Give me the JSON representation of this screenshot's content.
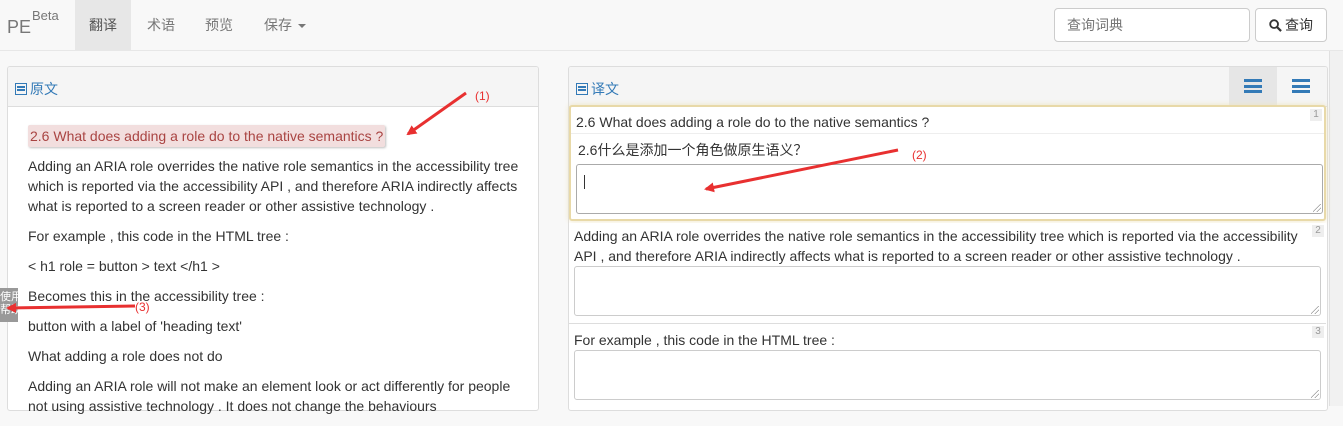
{
  "navbar": {
    "brand": "PE",
    "brand_sup": "Beta",
    "items": [
      {
        "label": "翻译"
      },
      {
        "label": "术语"
      },
      {
        "label": "预览"
      },
      {
        "label": "保存"
      }
    ],
    "search_placeholder": "查询词典",
    "search_button": "查询"
  },
  "source_panel": {
    "title": "原文",
    "highlighted": "2.6 What does adding a role do to the native semantics ?",
    "paragraphs": [
      "Adding an ARIA role overrides the native role semantics in the accessibility tree which is reported via the accessibility API , and therefore ARIA indirectly affects what is reported to a screen reader or other assistive technology .",
      "For example , this code in the HTML tree :",
      "< h1 role = button > text </h1 >",
      "Becomes this in the accessibility tree :",
      "button with a label of 'heading text'",
      "What adding a role does not do",
      "Adding an ARIA role will not make an element look or act differently for people not using assistive technology . It does not change the behaviours"
    ],
    "side_tab": "使用\n帮助"
  },
  "target_panel": {
    "title": "译文",
    "segments": [
      {
        "number": "1",
        "source": "2.6 What does adding a role do to the native semantics ?",
        "suggestion": "2.6什么是添加一个角色做原生语义？",
        "value": ""
      },
      {
        "number": "2",
        "source": "Adding an ARIA role overrides the native role semantics in the accessibility tree which is reported via the accessibility API , and therefore ARIA indirectly affects what is reported to a screen reader or other assistive technology .",
        "value": ""
      },
      {
        "number": "3",
        "source": "For example , this code in the HTML tree :",
        "value": ""
      }
    ]
  },
  "annotations": [
    "(1)",
    "(2)",
    "(3)"
  ],
  "colors": {
    "accent": "#337ab7",
    "highlight_bg": "#f2dede",
    "highlight_text": "#a94442",
    "arrow": "#e83030",
    "focus_border": "#e8d9a8"
  }
}
